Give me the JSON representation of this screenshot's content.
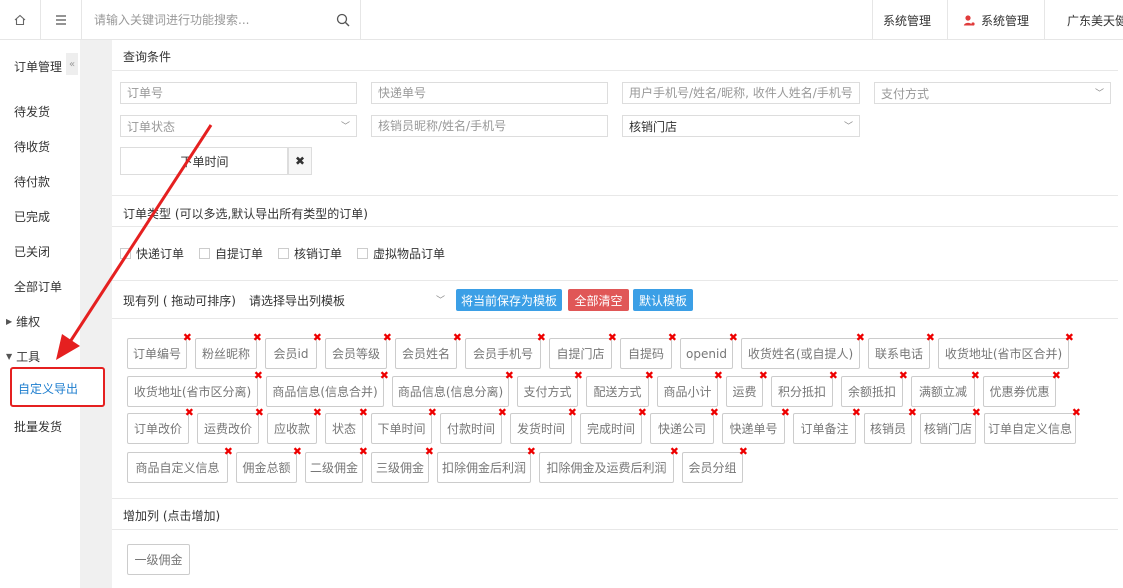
{
  "topbar": {
    "search_placeholder": "请输入关键词进行功能搜索...",
    "right_items": [
      "系统管理",
      "系统管理",
      "广东美天健"
    ]
  },
  "sidebar": {
    "title": "订单管理",
    "items": [
      "待发货",
      "待收货",
      "待付款",
      "已完成",
      "已关闭",
      "全部订单"
    ],
    "groups": [
      {
        "label": "维权"
      },
      {
        "label": "工具"
      }
    ],
    "active": "自定义导出",
    "after": "批量发货"
  },
  "query": {
    "title": "查询条件",
    "fields": {
      "order_no": "订单号",
      "express_no": "快递单号",
      "user": "用户手机号/姓名/昵称, 收件人姓名/手机号",
      "payment": "支付方式",
      "status": "订单状态",
      "verifier": "核销员昵称/姓名/手机号",
      "store": "核销门店"
    },
    "date_label": "下单时间",
    "clear_icon": "✖"
  },
  "order_type": {
    "title": "订单类型 (可以多选,默认导出所有类型的订单)",
    "options": [
      "快递订单",
      "自提订单",
      "核销订单",
      "虚拟物品订单"
    ]
  },
  "columns": {
    "title": "现有列 ( 拖动可排序)",
    "template_select": "请选择导出列模板",
    "buttons": {
      "save": "将当前保存为模板",
      "clear": "全部清空",
      "default": "默认模板"
    },
    "colors": {
      "save": "#3b9fe6",
      "clear": "#e05757",
      "default": "#3b9fe6"
    },
    "tags": [
      "订单编号",
      "粉丝昵称",
      "会员id",
      "会员等级",
      "会员姓名",
      "会员手机号",
      "自提门店",
      "自提码",
      "openid",
      "收货姓名(或自提人)",
      "联系电话",
      "收货地址(省市区合并)",
      "收货地址(省市区分离)",
      "商品信息(信息合并)",
      "商品信息(信息分离)",
      "支付方式",
      "配送方式",
      "商品小计",
      "运费",
      "积分抵扣",
      "余额抵扣",
      "满额立减",
      "优惠券优惠",
      "订单改价",
      "运费改价",
      "应收款",
      "状态",
      "下单时间",
      "付款时间",
      "发货时间",
      "完成时间",
      "快递公司",
      "快递单号",
      "订单备注",
      "核销员",
      "核销门店",
      "订单自定义信息",
      "商品自定义信息",
      "佣金总额",
      "二级佣金",
      "三级佣金",
      "扣除佣金后利润",
      "扣除佣金及运费后利润",
      "会员分组"
    ]
  },
  "add_columns": {
    "title": "增加列 (点击增加)",
    "tags": [
      "一级佣金"
    ]
  }
}
